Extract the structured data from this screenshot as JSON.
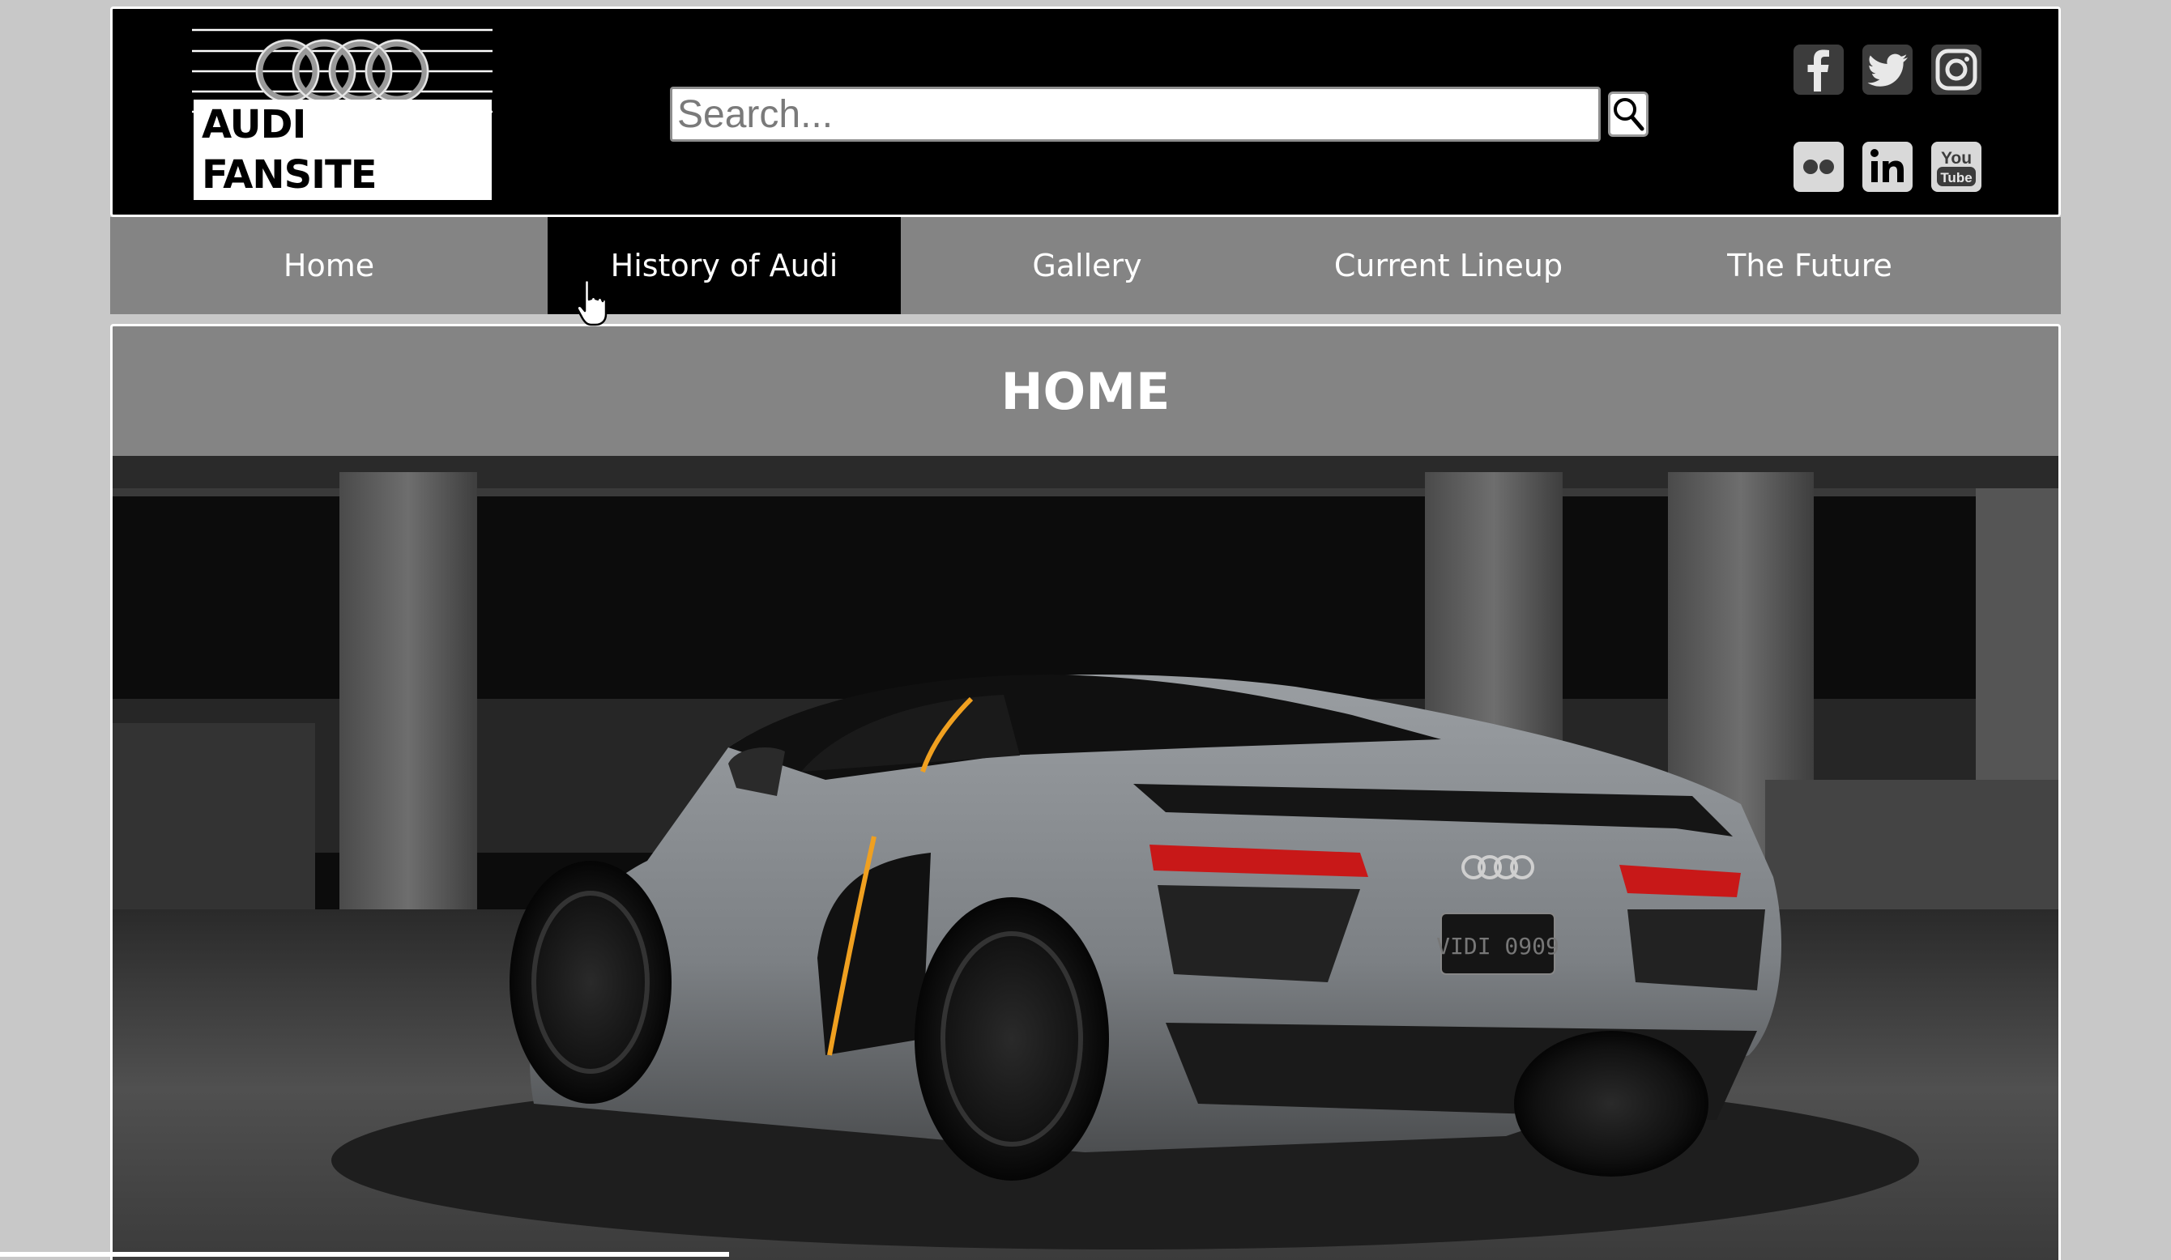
{
  "header": {
    "logo_text": "AUDI FANSITE",
    "search": {
      "placeholder": "Search...",
      "value": ""
    },
    "search_button_icon": "magnifier-icon",
    "social": [
      {
        "name": "facebook-icon"
      },
      {
        "name": "twitter-icon"
      },
      {
        "name": "instagram-icon"
      },
      {
        "name": "flickr-icon"
      },
      {
        "name": "linkedin-icon"
      },
      {
        "name": "youtube-icon",
        "label_top": "You",
        "label_bottom": "Tube"
      }
    ]
  },
  "nav": {
    "items": [
      {
        "label": "Home"
      },
      {
        "label": "History of Audi",
        "active": true
      },
      {
        "label": "Gallery"
      },
      {
        "label": "Current Lineup"
      },
      {
        "label": "The Future"
      }
    ]
  },
  "main": {
    "heading": "HOME",
    "hero_image": "audi-r8-grey-parking-garage",
    "plate_text": "VIDI 0909"
  },
  "colors": {
    "header_bg": "#000000",
    "nav_bg": "#848484",
    "nav_active_bg": "#000000",
    "page_bg": "#c8c8c8",
    "accent_orange": "#f0a020"
  }
}
